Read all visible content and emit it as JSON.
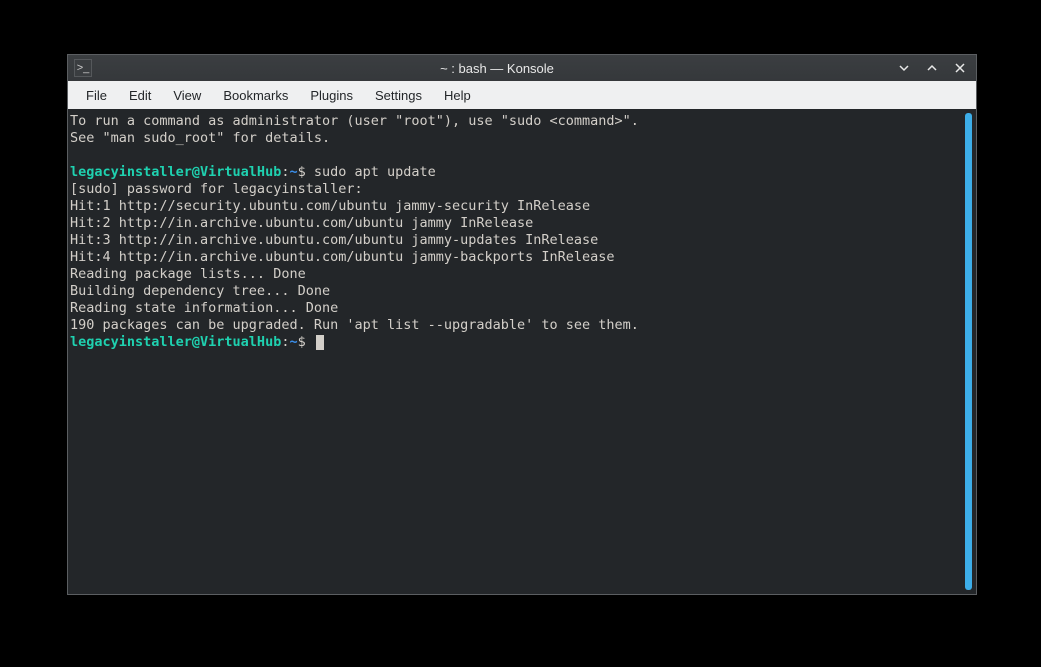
{
  "window": {
    "title": "~ : bash — Konsole",
    "app_icon_glyph": ">_"
  },
  "menu": {
    "file": "File",
    "edit": "Edit",
    "view": "View",
    "bookmarks": "Bookmarks",
    "plugins": "Plugins",
    "settings": "Settings",
    "help": "Help"
  },
  "terminal": {
    "intro1": "To run a command as administrator (user \"root\"), use \"sudo <command>\".",
    "intro2": "See \"man sudo_root\" for details.",
    "prompt1": {
      "userhost": "legacyinstaller@VirtualHub",
      "colon": ":",
      "path": "~",
      "sym": "$ ",
      "cmd": "sudo apt update"
    },
    "lines": [
      "[sudo] password for legacyinstaller:",
      "Hit:1 http://security.ubuntu.com/ubuntu jammy-security InRelease",
      "Hit:2 http://in.archive.ubuntu.com/ubuntu jammy InRelease",
      "Hit:3 http://in.archive.ubuntu.com/ubuntu jammy-updates InRelease",
      "Hit:4 http://in.archive.ubuntu.com/ubuntu jammy-backports InRelease",
      "Reading package lists... Done",
      "Building dependency tree... Done",
      "Reading state information... Done",
      "190 packages can be upgraded. Run 'apt list --upgradable' to see them."
    ],
    "prompt2": {
      "userhost": "legacyinstaller@VirtualHub",
      "colon": ":",
      "path": "~",
      "sym": "$ "
    }
  },
  "colors": {
    "accent": "#3daee9",
    "prompt_userhost": "#1fd1b0",
    "prompt_path": "#3a8eea",
    "terminal_bg": "#232629",
    "terminal_fg": "#d3cfc9"
  }
}
